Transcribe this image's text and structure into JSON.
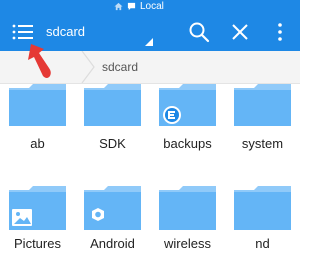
{
  "status_bar": {
    "title": "Local",
    "icons": [
      "home-icon",
      "message-icon"
    ]
  },
  "app_bar": {
    "path_title": "sdcard",
    "icons": [
      "menu-icon",
      "search-icon",
      "close-icon",
      "more-vert-icon"
    ]
  },
  "breadcrumb": {
    "current": "sdcard"
  },
  "folders": [
    {
      "name": "ab",
      "badge": ""
    },
    {
      "name": "SDK",
      "badge": ""
    },
    {
      "name": "backups",
      "badge": "es-logo-icon"
    },
    {
      "name": "system",
      "badge": ""
    },
    {
      "name": "Pictures",
      "badge": "image-icon"
    },
    {
      "name": "Android",
      "badge": "gear-icon"
    },
    {
      "name": "wireless",
      "badge": ""
    },
    {
      "name": "nd",
      "badge": ""
    }
  ],
  "colors": {
    "primary": "#1e88e5",
    "folder": "#64b5f6",
    "folder_tab": "#90caf9",
    "pointer": "#e53935"
  }
}
